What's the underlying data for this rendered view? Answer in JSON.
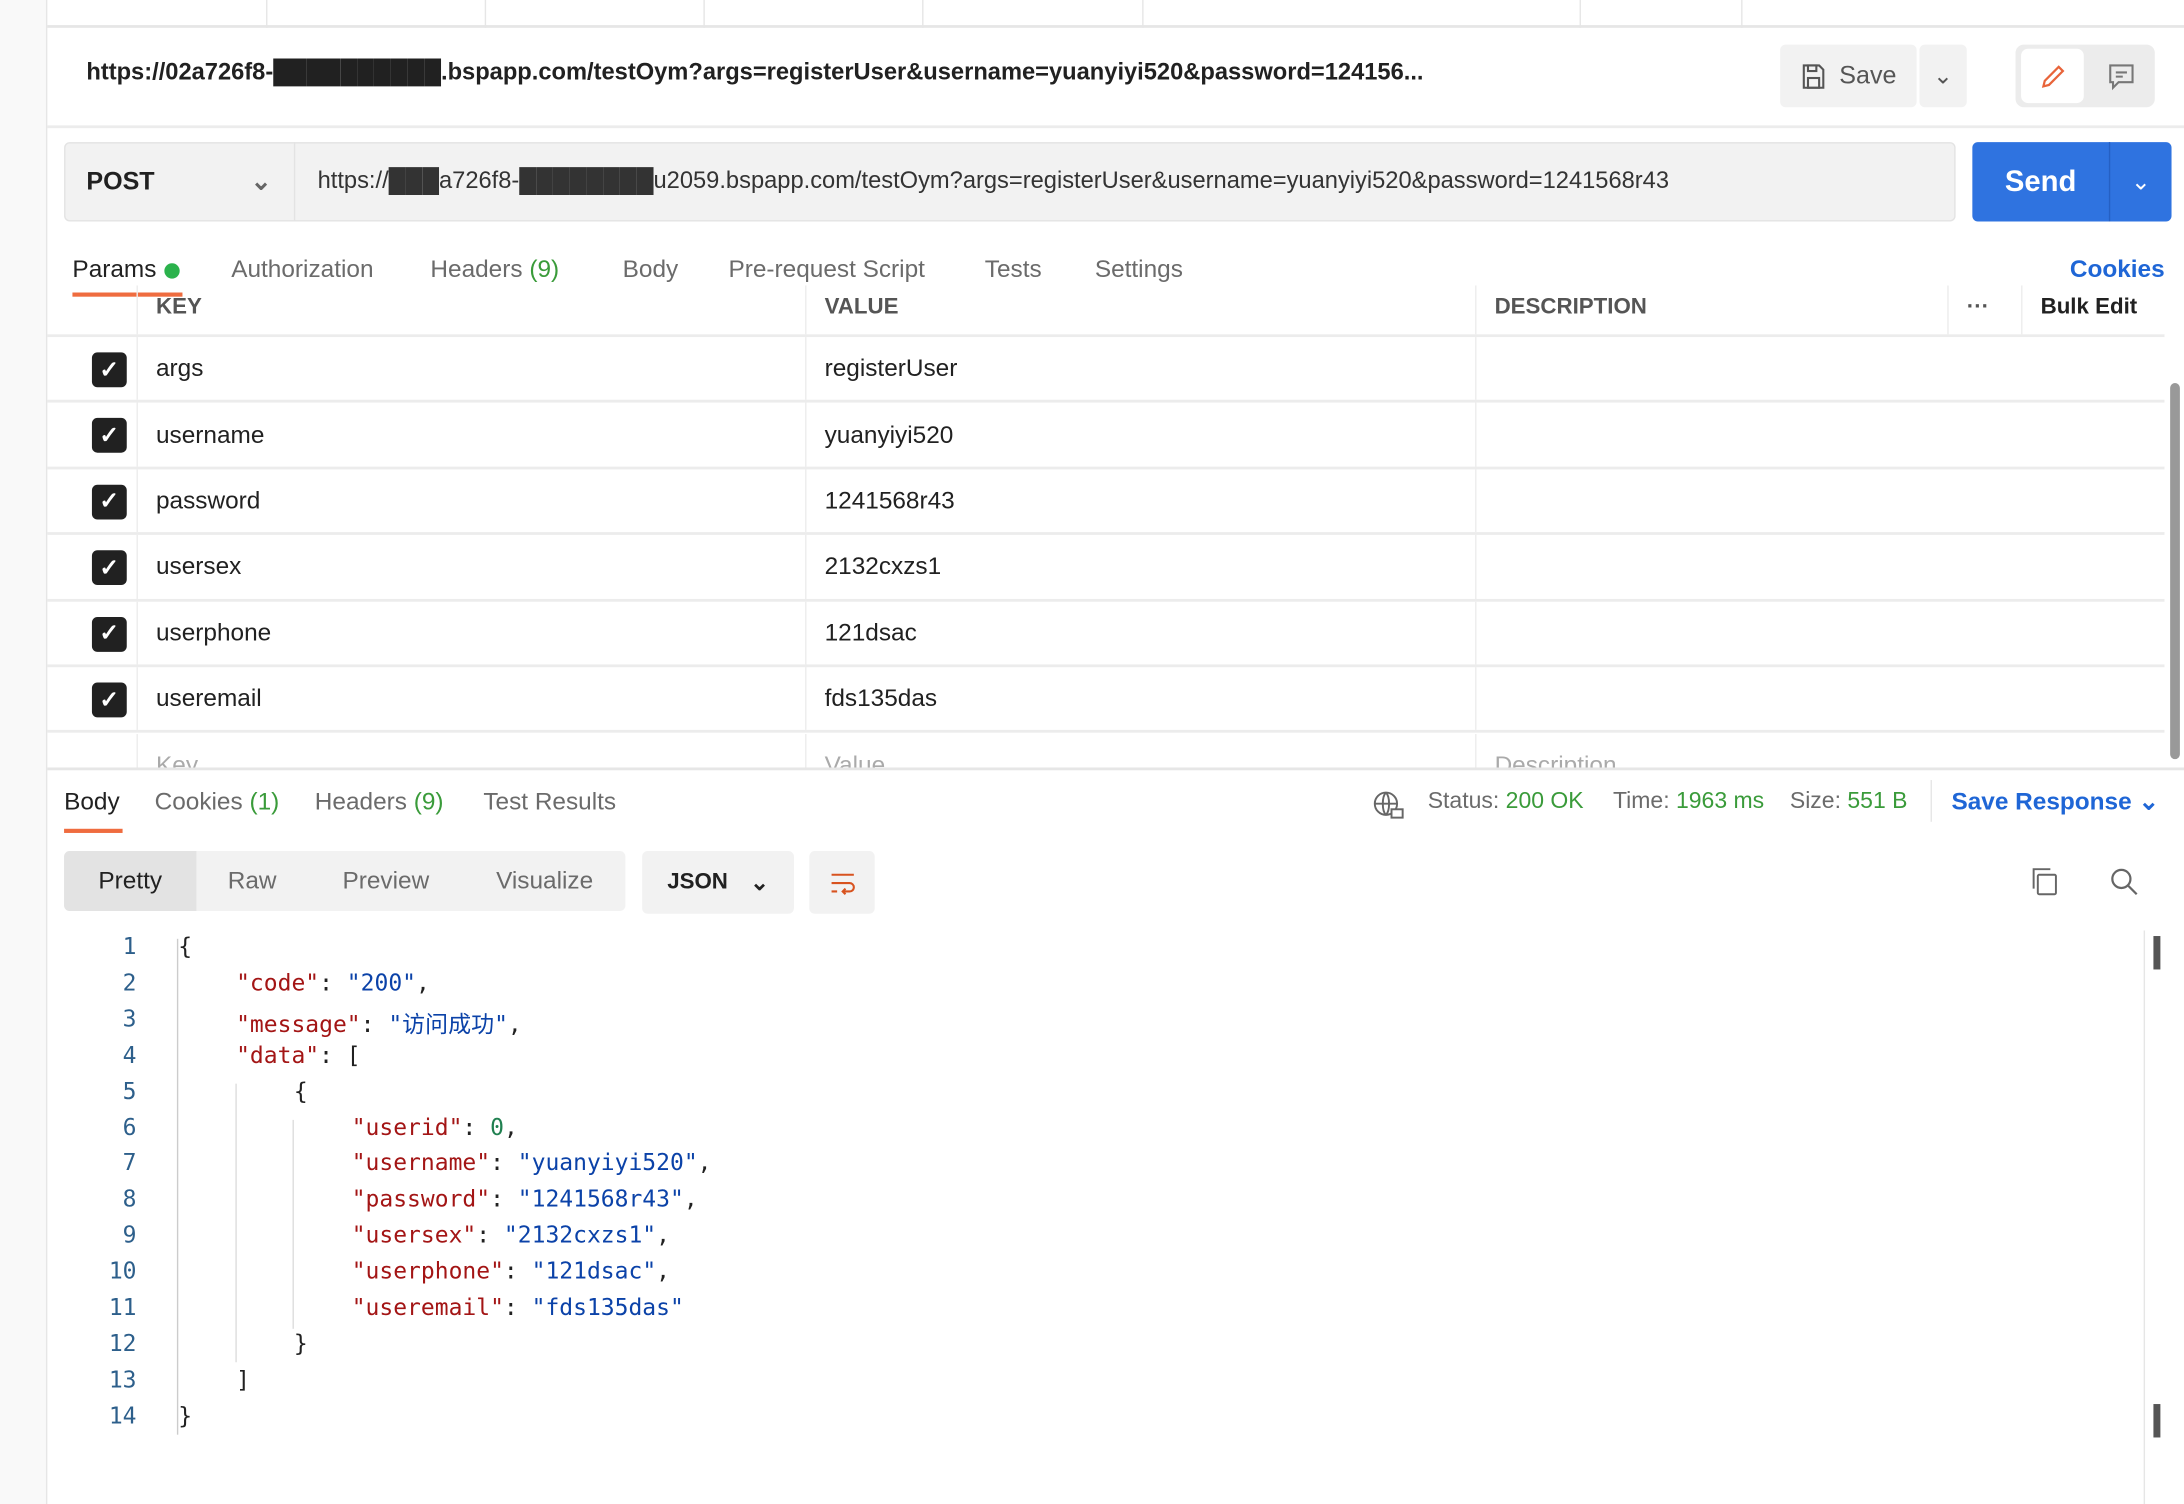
{
  "header": {
    "url_title": "https://02a726f8-██████████.bspapp.com/testOym?args=registerUser&username=yuanyiyi520&password=124156...",
    "save_label": "Save"
  },
  "request": {
    "method": "POST",
    "url": "https://███a726f8-████████u2059.bspapp.com/testOym?args=registerUser&username=yuanyiyi520&password=1241568r43",
    "send_label": "Send"
  },
  "req_tabs": {
    "params": "Params",
    "authorization": "Authorization",
    "headers": "Headers",
    "headers_count": "(9)",
    "body": "Body",
    "prerequest": "Pre-request Script",
    "tests": "Tests",
    "settings": "Settings",
    "cookies": "Cookies"
  },
  "params_table": {
    "columns": {
      "key": "KEY",
      "value": "VALUE",
      "description": "DESCRIPTION",
      "more": "···",
      "bulk_edit": "Bulk Edit"
    },
    "rows": [
      {
        "key": "args",
        "value": "registerUser",
        "checked": true
      },
      {
        "key": "username",
        "value": "yuanyiyi520",
        "checked": true
      },
      {
        "key": "password",
        "value": "1241568r43",
        "checked": true
      },
      {
        "key": "usersex",
        "value": "2132cxzs1",
        "checked": true
      },
      {
        "key": "userphone",
        "value": "121dsac",
        "checked": true
      },
      {
        "key": "useremail",
        "value": "fds135das",
        "checked": true
      }
    ],
    "placeholders": {
      "key": "Key",
      "value": "Value",
      "description": "Description"
    }
  },
  "response": {
    "tabs": {
      "body": "Body",
      "cookies": "Cookies",
      "cookies_count": "(1)",
      "headers": "Headers",
      "headers_count": "(9)",
      "test_results": "Test Results"
    },
    "status_label": "Status:",
    "status": "200 OK",
    "time_label": "Time:",
    "time": "1963 ms",
    "size_label": "Size:",
    "size": "551 B",
    "save_response": "Save Response",
    "views": {
      "pretty": "Pretty",
      "raw": "Raw",
      "preview": "Preview",
      "visualize": "Visualize"
    },
    "format": "JSON",
    "body_lines": [
      "1",
      "2",
      "3",
      "4",
      "5",
      "6",
      "7",
      "8",
      "9",
      "10",
      "11",
      "12",
      "13",
      "14"
    ],
    "json": {
      "code": "200",
      "message": "访问成功",
      "userid": "0",
      "username": "yuanyiyi520",
      "password": "1241568r43",
      "usersex": "2132cxzs1",
      "userphone": "121dsac",
      "useremail": "fds135das"
    }
  },
  "colors": {
    "accent": "#ef6c3f",
    "send": "#2f73e0",
    "link": "#1f66d6",
    "success": "#3a9b3a"
  }
}
